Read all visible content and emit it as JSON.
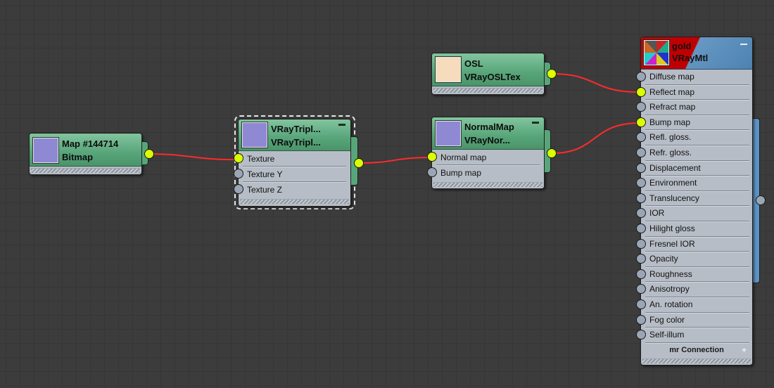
{
  "nodes": {
    "bitmap": {
      "title_line1": "Map #144714",
      "title_line2": "Bitmap"
    },
    "triplanar": {
      "title_line1": "VRayTripl...",
      "title_line2": "VRayTripl...",
      "slots": [
        "Texture",
        "Texture Y",
        "Texture Z"
      ]
    },
    "osl": {
      "title_line1": "OSL",
      "title_line2": "VRayOSLTex"
    },
    "normalmap": {
      "title_line1": "NormalMap",
      "title_line2": "VRayNor...",
      "slots": [
        "Normal map",
        "Bump map"
      ]
    },
    "material": {
      "title_line1": "gold",
      "title_line2": "VRayMtl",
      "slots": [
        "Diffuse map",
        "Reflect map",
        "Refract map",
        "Bump map",
        "Refl. gloss.",
        "Refr. gloss.",
        "Displacement",
        "Environment",
        "Translucency",
        "IOR",
        "Hilight gloss",
        "Fresnel IOR",
        "Opacity",
        "Roughness",
        "Anisotropy",
        "An. rotation",
        "Fog color",
        "Self-illum"
      ],
      "footer_label": "mr Connection",
      "footer_plus": "+"
    }
  },
  "colors": {
    "background": "#3c3c3c",
    "node_header": "#58a57a",
    "material_header": "#4d82b1",
    "wire": "#ff2a2a",
    "port_active": "#d9ff00",
    "port_idle": "#9aa6b6"
  }
}
